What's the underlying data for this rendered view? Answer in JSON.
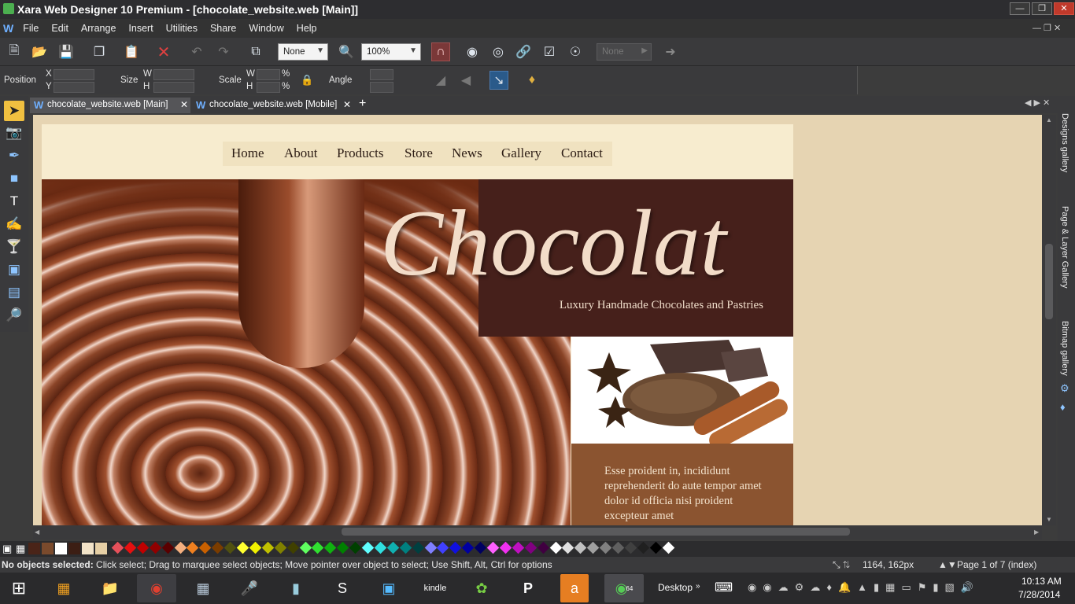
{
  "window": {
    "title": "Xara Web Designer 10 Premium - [chocolate_website.web [Main]]"
  },
  "menu": [
    "File",
    "Edit",
    "Arrange",
    "Insert",
    "Utilities",
    "Share",
    "Window",
    "Help"
  ],
  "toolbar": {
    "quality_value": "None",
    "zoom_value": "100%",
    "feather_value": "None"
  },
  "infobar": {
    "position_label": "Position",
    "x_label": "X",
    "y_label": "Y",
    "size_label": "Size",
    "w_label": "W",
    "h_label": "H",
    "scale_label": "Scale",
    "scale_w_label": "W",
    "scale_h_label": "H",
    "pct": "%",
    "angle_label": "Angle"
  },
  "tabs": [
    {
      "label": "chocolate_website.web [Main]",
      "active": true
    },
    {
      "label": "chocolate_website.web [Mobile]",
      "active": false
    }
  ],
  "site": {
    "nav": [
      "Home",
      "About",
      "Products",
      "Store",
      "News",
      "Gallery",
      "Contact"
    ],
    "logo": "Chocolat",
    "tagline": "Luxury Handmade Chocolates and Pastries",
    "body": "Esse proident in, incididunt reprehenderit do aute tempor amet dolor id officia nisi proident excepteur amet"
  },
  "right_panel": [
    "Designs gallery",
    "Page & Layer Gallery",
    "Bitmap gallery"
  ],
  "status": {
    "bold": "No objects selected:",
    "message": " Click select; Drag to marquee select objects; Move pointer over object to select; Use Shift, Alt, Ctrl for options",
    "coords": "1164, 162px",
    "page": "Page 1 of 7 (index)"
  },
  "taskbar": {
    "desktop_label": "Desktop",
    "time": "10:13 AM",
    "date": "7/28/2014",
    "app_badge": "64"
  },
  "colors": {
    "page_bg": "#f7eccf",
    "brown_panel": "#46201b",
    "text_panel": "#8b5430",
    "canvas_bg": "#e6d4b2"
  },
  "palette": [
    "#4a2418",
    "#7a4a2c",
    "#ffffff",
    "#3c1e14",
    "#f2e3c8",
    "#e6cfa5",
    "#e6505a",
    "#e51010",
    "#c00000",
    "#900000",
    "#5a0000",
    "#f5b080",
    "#f08020",
    "#c86000",
    "#7a3c00",
    "#505010",
    "#ffff30",
    "#f0f000",
    "#c0c000",
    "#808000",
    "#404000",
    "#60ff60",
    "#30e030",
    "#10b010",
    "#008000",
    "#004000",
    "#60ffff",
    "#30e0e0",
    "#10b0b0",
    "#008080",
    "#004040",
    "#8080ff",
    "#4040ff",
    "#1010e0",
    "#0000a0",
    "#000060",
    "#ff60ff",
    "#f030f0",
    "#c010c0",
    "#800080",
    "#400040",
    "#ffffff",
    "#e0e0e0",
    "#c0c0c0",
    "#a0a0a0",
    "#808080",
    "#606060",
    "#404040",
    "#202020",
    "#000000",
    "#ffffff"
  ]
}
